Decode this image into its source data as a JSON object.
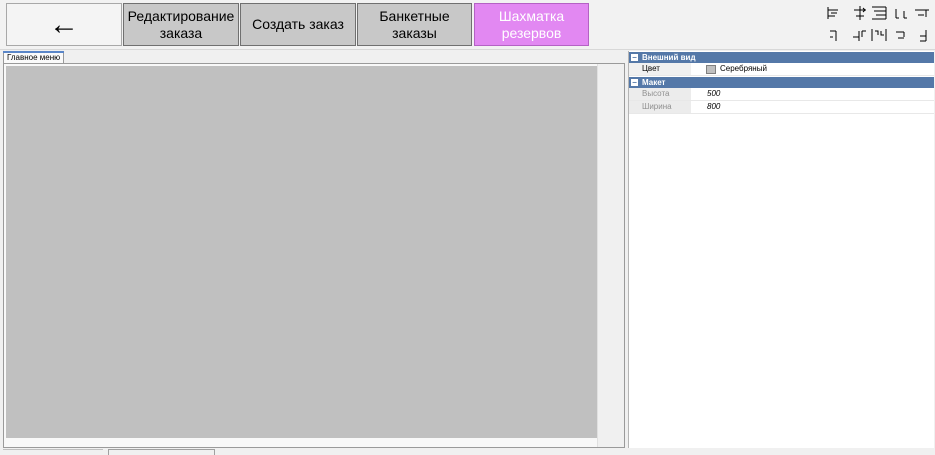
{
  "toolbar": {
    "back_label": "←",
    "edit_order_label": "Редактирование\nзаказа",
    "create_order_label": "Создать заказ",
    "banquet_orders_label": "Банкетные\nзаказы",
    "reservation_chess_label": "Шахматка\nрезервов",
    "active_color": "#e288f2",
    "button_color": "#c8c8c8"
  },
  "align_tools": [
    "align-left-icon",
    "align-center-horizontal-icon",
    "align-right-icon",
    "distribute-horizontal-icon",
    "align-top-icon",
    "align-center-vertical-icon",
    "align-bottom-icon",
    "distribute-vertical-icon",
    "same-width-icon",
    "same-height-icon"
  ],
  "designer": {
    "tab_label": "Главное меню",
    "canvas_color": "#c0c0c0"
  },
  "properties": {
    "categories": [
      {
        "name": "Внешний вид",
        "rows": [
          {
            "name": "Цвет",
            "value": "Серебряный"
          }
        ]
      },
      {
        "name": "Макет",
        "rows": [
          {
            "name": "Высота",
            "value": "500"
          },
          {
            "name": "Ширина",
            "value": "800"
          }
        ]
      }
    ]
  }
}
